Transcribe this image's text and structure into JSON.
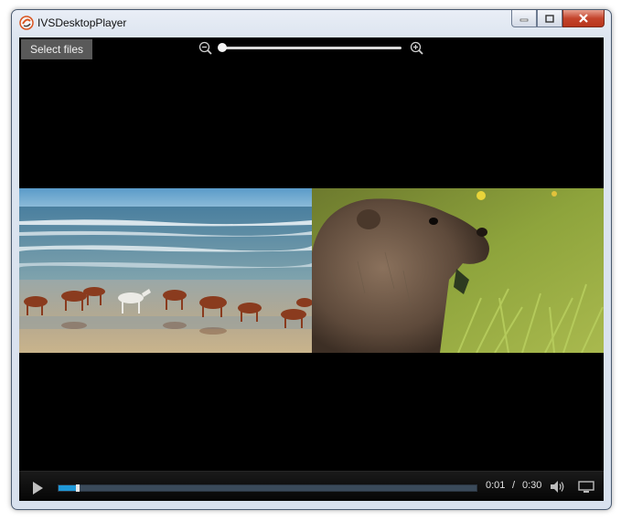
{
  "window": {
    "title": "IVSDesktopPlayer"
  },
  "toolbar": {
    "select_files_label": "Select files",
    "zoom_level": 0.0
  },
  "icons": {
    "app": "app-logo-icon",
    "minimize": "minimize-icon",
    "maximize": "maximize-icon",
    "close": "close-icon",
    "zoom_out": "zoom-out-icon",
    "zoom_in": "zoom-in-icon",
    "play": "play-icon",
    "volume": "volume-icon",
    "screen": "display-icon"
  },
  "player": {
    "current_time": "0:01",
    "separator": "/",
    "total_time": "0:30",
    "progress": 0.045
  },
  "colors": {
    "accent": "#1f98d8",
    "video_background": "#000000",
    "close_button": "#c4452c"
  }
}
